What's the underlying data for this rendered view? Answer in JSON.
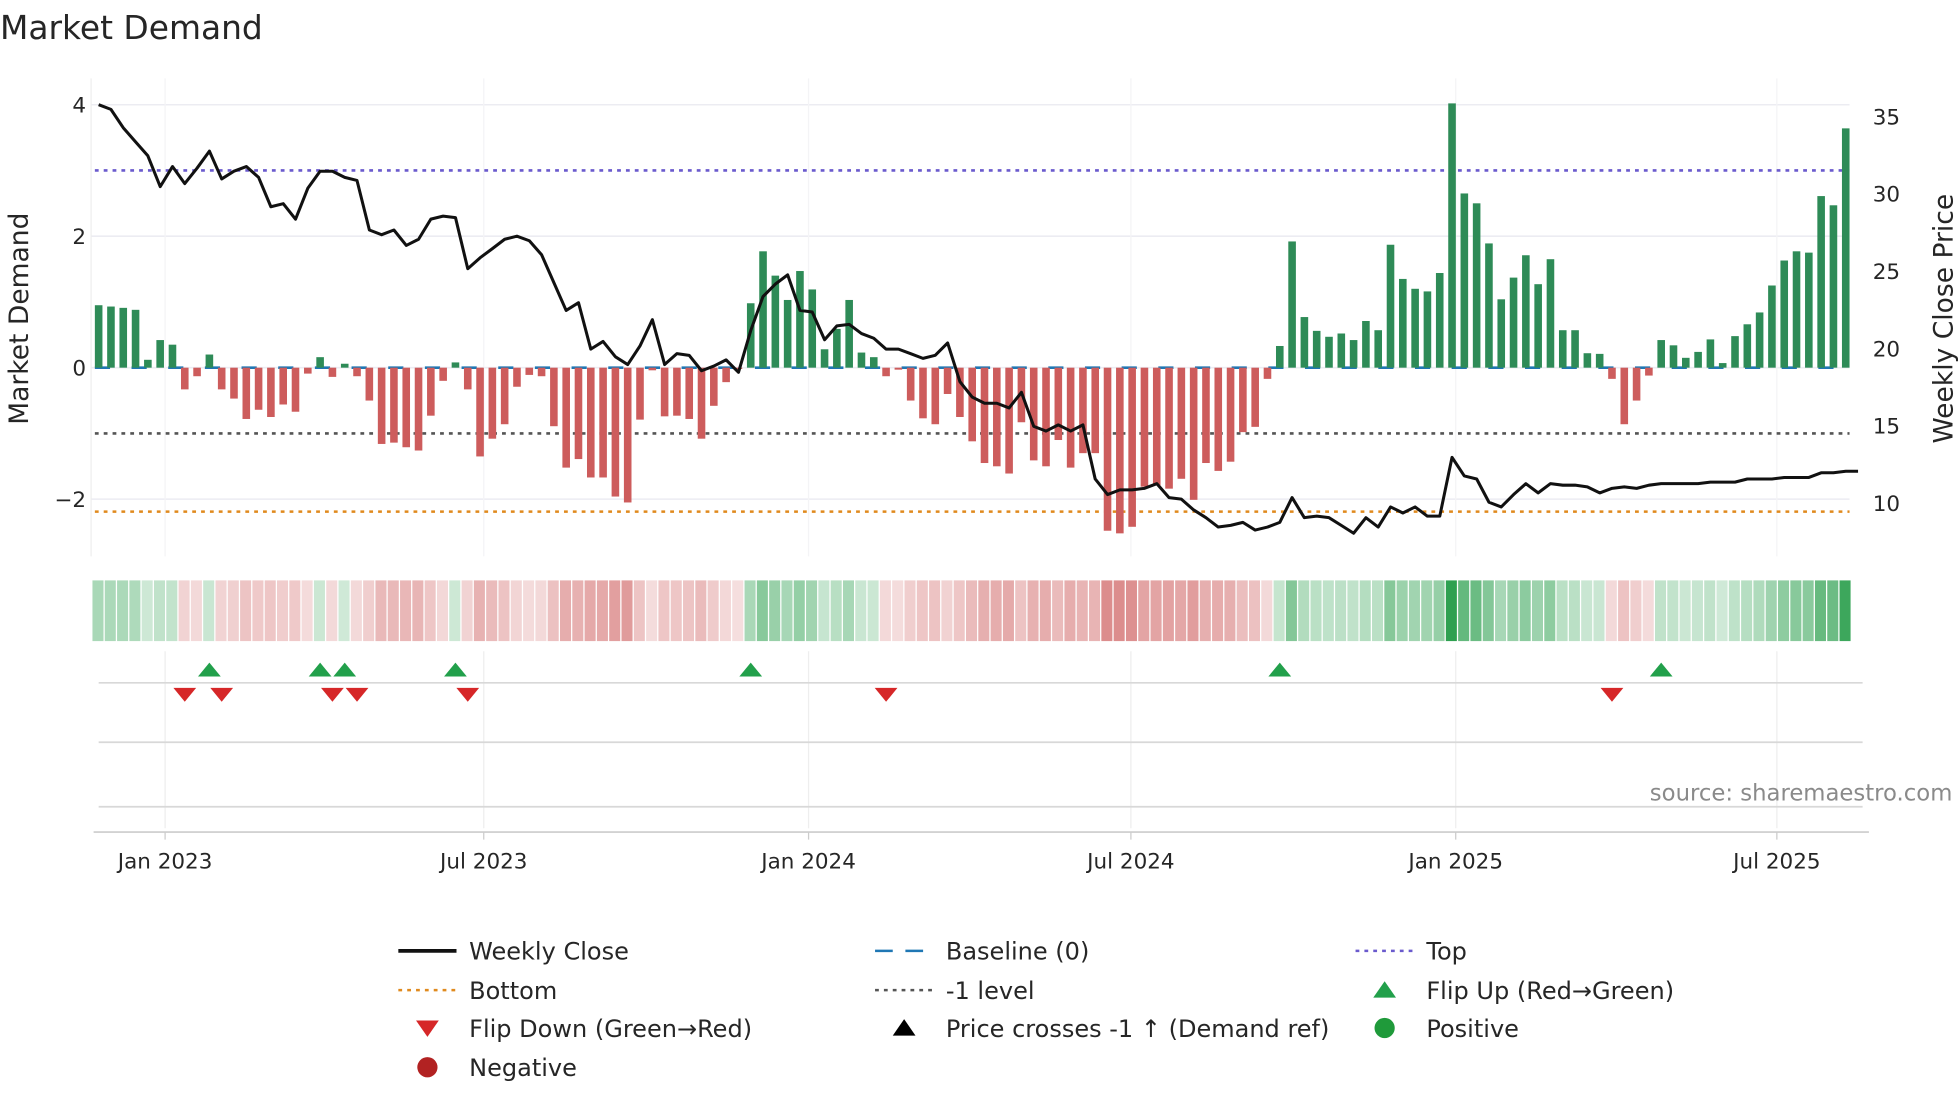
{
  "chart_data": {
    "type": "bar",
    "title": "Market Demand",
    "ylabel": "Market Demand",
    "y2label": "Weekly Close Price",
    "ylim": [
      -2.87,
      4.4
    ],
    "y2lim": [
      6.5,
      37.4
    ],
    "yticks": [
      4,
      2,
      0,
      -2
    ],
    "ytick_labels": [
      "4",
      "2",
      "0",
      "−2"
    ],
    "y2ticks": [
      35,
      30,
      25,
      20,
      15,
      10
    ],
    "xticks": [
      {
        "label": "Jan 2023",
        "week": 5.4
      },
      {
        "label": "Jul 2023",
        "week": 31.3
      },
      {
        "label": "Jan 2024",
        "week": 57.7
      },
      {
        "label": "Jul 2024",
        "week": 83.9
      },
      {
        "label": "Jan 2025",
        "week": 110.3
      },
      {
        "label": "Jul 2025",
        "week": 136.4
      }
    ],
    "levels": {
      "baseline": 0,
      "top": 3.0,
      "bottom": -2.19,
      "minus_one": -1.0
    },
    "demand": [
      0.95,
      0.93,
      0.91,
      0.88,
      0.12,
      0.42,
      0.35,
      -0.33,
      -0.13,
      0.2,
      -0.33,
      -0.47,
      -0.78,
      -0.64,
      -0.75,
      -0.56,
      -0.67,
      -0.09,
      0.16,
      -0.14,
      0.06,
      -0.13,
      -0.5,
      -1.16,
      -1.14,
      -1.21,
      -1.26,
      -0.73,
      -0.2,
      0.08,
      -0.33,
      -1.35,
      -1.08,
      -0.86,
      -0.29,
      -0.11,
      -0.13,
      -0.89,
      -1.52,
      -1.39,
      -1.67,
      -1.67,
      -1.96,
      -2.05,
      -0.79,
      -0.04,
      -0.74,
      -0.73,
      -0.78,
      -1.08,
      -0.58,
      -0.22,
      -0.02,
      0.98,
      1.77,
      1.4,
      1.03,
      1.47,
      1.19,
      0.28,
      0.59,
      1.03,
      0.23,
      0.16,
      -0.13,
      -0.03,
      -0.5,
      -0.77,
      -0.86,
      -0.4,
      -0.75,
      -1.12,
      -1.45,
      -1.5,
      -1.61,
      -0.83,
      -1.41,
      -1.5,
      -1.1,
      -1.52,
      -1.3,
      -1.3,
      -2.48,
      -2.52,
      -2.42,
      -1.81,
      -1.79,
      -1.84,
      -1.69,
      -2.01,
      -1.45,
      -1.57,
      -1.43,
      -0.98,
      -0.9,
      -0.17,
      0.33,
      1.92,
      0.77,
      0.56,
      0.47,
      0.52,
      0.42,
      0.71,
      0.57,
      1.87,
      1.35,
      1.2,
      1.16,
      1.44,
      4.02,
      2.65,
      2.5,
      1.89,
      1.04,
      1.37,
      1.71,
      1.27,
      1.65,
      0.57,
      0.57,
      0.22,
      0.21,
      -0.17,
      -0.86,
      -0.5,
      -0.12,
      0.42,
      0.34,
      0.15,
      0.24,
      0.43,
      0.07,
      0.48,
      0.66,
      0.84,
      1.25,
      1.63,
      1.77,
      1.75,
      2.61,
      2.47,
      3.64
    ],
    "weekly_close": [
      35.7,
      35.4,
      34.2,
      33.3,
      32.4,
      30.4,
      31.7,
      30.6,
      31.6,
      32.7,
      30.9,
      31.4,
      31.7,
      31.0,
      29.1,
      29.3,
      28.3,
      30.3,
      31.4,
      31.4,
      31.0,
      30.8,
      27.6,
      27.3,
      27.6,
      26.6,
      27.0,
      28.3,
      28.5,
      28.4,
      25.1,
      25.8,
      26.4,
      27.0,
      27.2,
      26.9,
      26.0,
      24.2,
      22.4,
      22.9,
      19.9,
      20.4,
      19.4,
      18.9,
      20.1,
      21.8,
      18.9,
      19.6,
      19.5,
      18.5,
      18.8,
      19.2,
      18.4,
      21.1,
      23.3,
      24.1,
      24.7,
      22.4,
      22.3,
      20.5,
      21.4,
      21.5,
      20.9,
      20.6,
      19.9,
      19.9,
      19.6,
      19.3,
      19.5,
      20.3,
      17.8,
      16.8,
      16.4,
      16.4,
      16.1,
      17.1,
      14.9,
      14.6,
      15.0,
      14.6,
      15.0,
      11.5,
      10.5,
      10.8,
      10.8,
      10.9,
      11.2,
      10.3,
      10.2,
      9.5,
      9.0,
      8.4,
      8.5,
      8.7,
      8.2,
      8.4,
      8.7,
      10.3,
      9.0,
      9.1,
      9.0,
      8.5,
      8.0,
      9.0,
      8.4,
      9.7,
      9.3,
      9.7,
      9.1,
      9.1,
      12.9,
      11.7,
      11.5,
      10.0,
      9.7,
      10.5,
      11.2,
      10.6,
      11.2,
      11.1,
      11.1,
      11.0,
      10.6,
      10.9,
      11.0,
      10.9,
      11.1,
      11.2,
      11.2,
      11.2,
      11.2,
      11.3,
      11.3,
      11.3,
      11.5,
      11.5,
      11.5,
      11.6,
      11.6,
      11.6,
      11.9,
      11.9,
      12.0,
      12.0
    ],
    "legend": {
      "placement": "bottom",
      "entries": [
        {
          "label": "Weekly Close",
          "kind": "line",
          "color": "#111111"
        },
        {
          "label": "Baseline (0)",
          "kind": "dash",
          "color": "#1f77b4"
        },
        {
          "label": "Top",
          "kind": "dot",
          "color": "#6a5acd"
        },
        {
          "label": "Bottom",
          "kind": "dot",
          "color": "#e08a1e"
        },
        {
          "label": "-1 level",
          "kind": "dot",
          "color": "#555555"
        },
        {
          "label": "Flip Up (Red→Green)",
          "kind": "tri-up",
          "color": "#22a04b"
        },
        {
          "label": "Flip Down (Green→Red)",
          "kind": "tri-down",
          "color": "#d62728"
        },
        {
          "label": "Price crosses -1 ↑ (Demand ref)",
          "kind": "tri-up",
          "color": "#000000"
        },
        {
          "label": "Positive",
          "kind": "circle",
          "color": "#1f9a3a"
        },
        {
          "label": "Negative",
          "kind": "circle",
          "color": "#b22222"
        }
      ]
    },
    "source": "source: sharemaestro.com",
    "colors": {
      "positive": "#2e8b57",
      "negative": "#cd5c5c",
      "price": "#111111"
    }
  }
}
